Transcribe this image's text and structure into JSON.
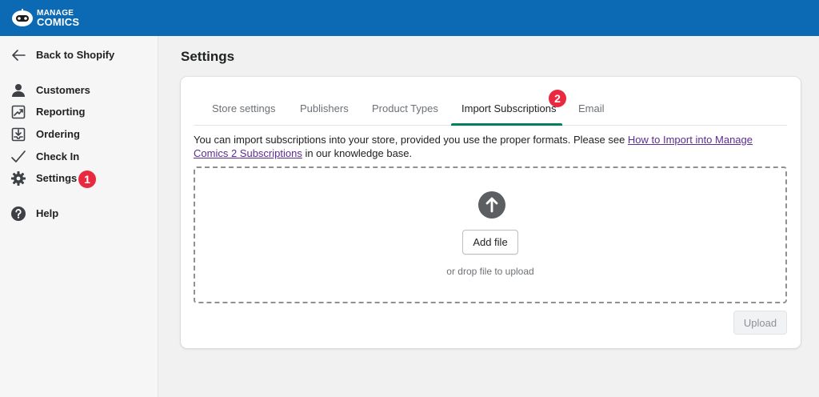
{
  "brand": {
    "logo_line1": "MANAGE",
    "logo_line2": "COMICS",
    "topbar_color": "#0c6ab5"
  },
  "sidebar": {
    "back": {
      "label": "Back to Shopify",
      "icon": "arrow-left-icon"
    },
    "items": [
      {
        "label": "Customers",
        "icon": "person-icon"
      },
      {
        "label": "Reporting",
        "icon": "trend-report-icon"
      },
      {
        "label": "Ordering",
        "icon": "inbox-download-icon"
      },
      {
        "label": "Check In",
        "icon": "checkmark-icon"
      },
      {
        "label": "Settings",
        "icon": "gear-icon",
        "active": true
      },
      {
        "label": "Help",
        "icon": "question-circle-icon"
      }
    ]
  },
  "annotations": {
    "marker1": "1",
    "marker2": "2",
    "color": "#e8293f"
  },
  "page": {
    "title": "Settings"
  },
  "tabs": [
    {
      "label": "Store settings"
    },
    {
      "label": "Publishers"
    },
    {
      "label": "Product Types"
    },
    {
      "label": "Import Subscriptions",
      "active": true
    },
    {
      "label": "Email"
    }
  ],
  "import": {
    "intro_before": "You can import subscriptions into your store, provided you use the proper formats. Please see ",
    "intro_link": "How to Import into Manage Comics 2 Subscriptions",
    "intro_after": " in our knowledge base.",
    "add_file_label": "Add file",
    "drop_hint": "or drop file to upload",
    "upload_label": "Upload",
    "upload_disabled": true
  }
}
